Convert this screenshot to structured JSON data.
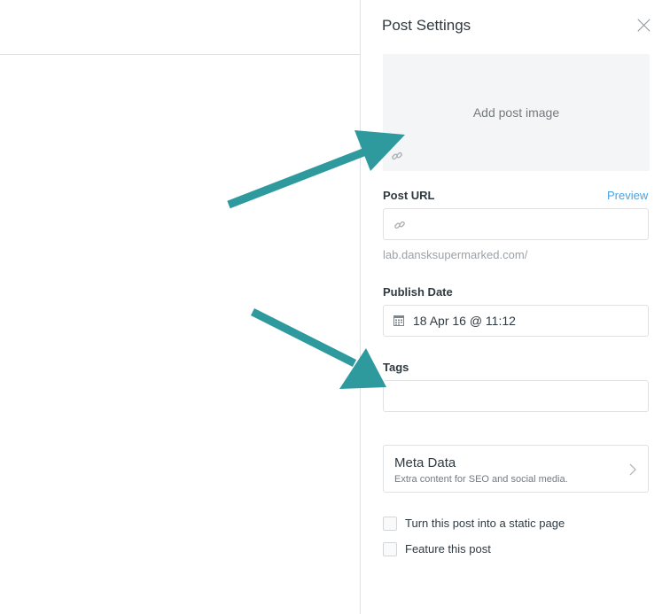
{
  "panel": {
    "title": "Post Settings",
    "image_placeholder": "Add post image",
    "post_url": {
      "label": "Post URL",
      "preview_label": "Preview",
      "value": "",
      "hint": "lab.dansksupermarked.com/"
    },
    "publish_date": {
      "label": "Publish Date",
      "value": "18 Apr 16 @ 11:12"
    },
    "tags": {
      "label": "Tags",
      "value": ""
    },
    "meta_data": {
      "title": "Meta Data",
      "subtitle": "Extra content for SEO and social media."
    },
    "checkboxes": [
      {
        "label": "Turn this post into a static page",
        "checked": false
      },
      {
        "label": "Feature this post",
        "checked": false
      }
    ]
  },
  "icons": {
    "close": "close-icon",
    "image_link": "link-icon",
    "url_link": "link-icon",
    "calendar": "calendar-icon",
    "meta_chevron": "chevron-right-icon"
  },
  "colors": {
    "annotation_arrow": "#2e9a9e",
    "link": "#4aa3df",
    "border": "#dfe1e3",
    "image_box_bg": "#f4f5f6"
  }
}
